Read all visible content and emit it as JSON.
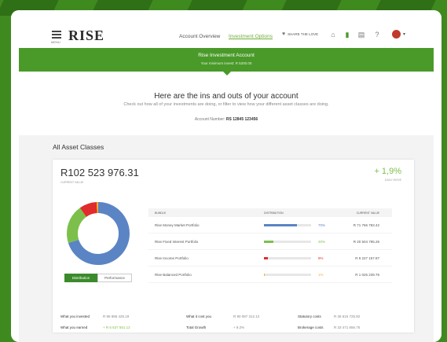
{
  "header": {
    "menu_label": "MENU",
    "logo": "RISE",
    "nav": [
      "Account Overview",
      "Investment Options"
    ],
    "share": "SHARE THE LOVE"
  },
  "banner": {
    "title": "Rise Investment Account",
    "subtitle": "Your minimum invest: R 5200.00"
  },
  "intro": {
    "heading": "Here are the ins and outs of your account",
    "sub": "Check out how all of your investments are doing, or filter to view how your different asset classes are doing.",
    "account_label": "Account Number:",
    "account_number": "RS 12845 123456"
  },
  "section_title": "All Asset Classes",
  "summary": {
    "total": "R102 523 976.31",
    "total_label": "CURRENT VALUE",
    "growth": "+ 1,9%",
    "growth_label": "DAILY MOVE"
  },
  "tabs": [
    "Distribution",
    "Performance"
  ],
  "table": {
    "headers": [
      "BUNDLE",
      "DISTRIBUTION",
      "CURRENT VALUE"
    ],
    "rows": [
      {
        "name": "Rise Money Market Portfolio",
        "pct": "70%",
        "value": "R 71 766 783.42",
        "fill": 0.7,
        "color": "#5b84c4"
      },
      {
        "name": "Rise Fixed Interest Portfolio",
        "pct": "20%",
        "value": "R 20 504 795.26",
        "fill": 0.2,
        "color": "#7cc04b"
      },
      {
        "name": "Rise Income Portfolio",
        "pct": "9%",
        "value": "R 9 227 157.87",
        "fill": 0.09,
        "color": "#e02c2c"
      },
      {
        "name": "Rise Balanced Portfolio",
        "pct": "1%",
        "value": "R 1 025 239.76",
        "fill": 0.01,
        "color": "#f4b223"
      }
    ]
  },
  "donut": [
    {
      "fraction": 0.7,
      "color": "#5b84c4"
    },
    {
      "fraction": 0.2,
      "color": "#7cc04b"
    },
    {
      "fraction": 0.09,
      "color": "#e02c2c"
    },
    {
      "fraction": 0.01,
      "color": "#f4b223"
    }
  ],
  "footer": [
    {
      "k": "What you invested",
      "v": "R 95 886 425.19"
    },
    {
      "k": "What it cost you",
      "v": "R 90 087 312.12"
    },
    {
      "k": "Statutory costs",
      "v": "R 36 615 725.82"
    },
    {
      "k": "What you earned",
      "v": "+ R 6 637 551.12"
    },
    {
      "k": "Total Growth",
      "v": "+ 9.2%"
    },
    {
      "k": "Brokerage costs",
      "v": "R 33 471 656.75"
    }
  ]
}
